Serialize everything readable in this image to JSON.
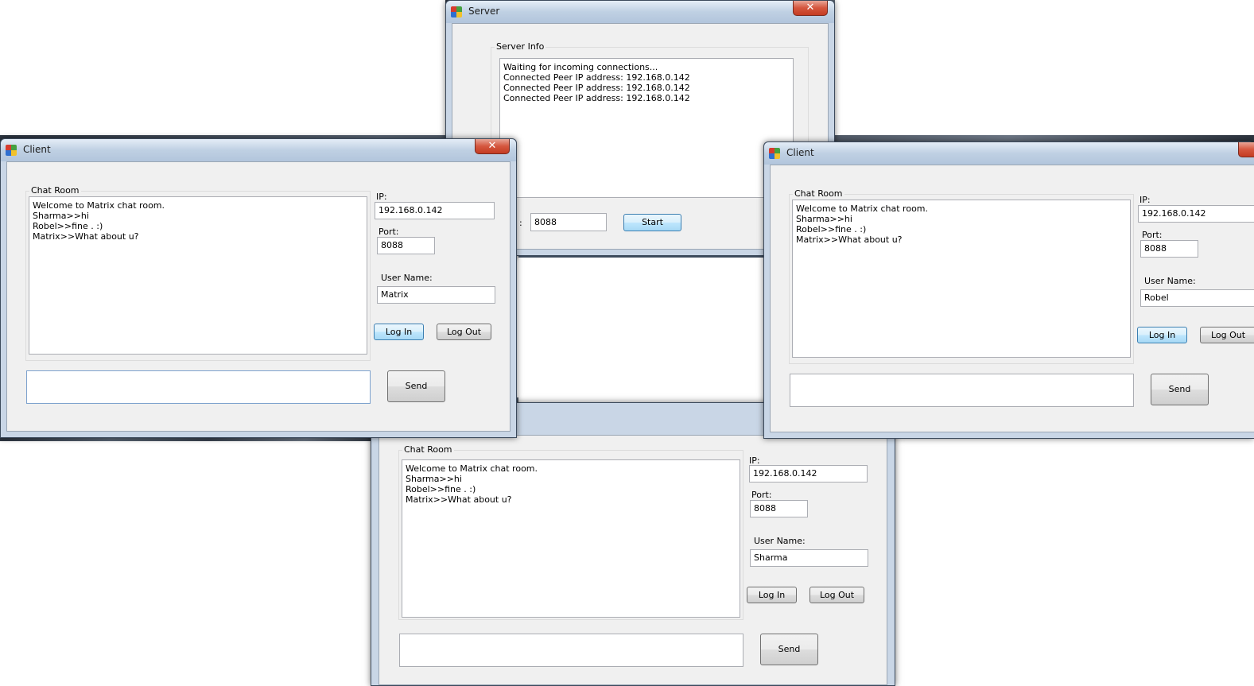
{
  "server": {
    "title": "Server",
    "close_glyph": "✕",
    "group_label": "Server Info",
    "log_lines": [
      "Waiting for incoming connections...",
      "Connected Peer IP address: 192.168.0.142",
      "Connected Peer IP address: 192.168.0.142",
      "Connected Peer IP address: 192.168.0.142"
    ],
    "port_label_fragment": ":",
    "port_value": "8088",
    "start_label": "Start"
  },
  "client_left": {
    "title": "Client",
    "close_glyph": "✕",
    "chat_group_label": "Chat Room",
    "chat_lines": [
      "Welcome to Matrix chat room.",
      "Sharma>>hi",
      "Robel>>fine . :)",
      "Matrix>>What about u?"
    ],
    "ip_label": "IP:",
    "ip_value": "192.168.0.142",
    "port_label": "Port:",
    "port_value": "8088",
    "username_label": "User Name:",
    "username_value": "Matrix",
    "login_label": "Log In",
    "logout_label": "Log Out",
    "message_value": "",
    "send_label": "Send"
  },
  "client_right": {
    "title": "Client",
    "chat_group_label": "Chat Room",
    "chat_lines": [
      "Welcome to Matrix chat room.",
      "Sharma>>hi",
      "Robel>>fine . :)",
      "Matrix>>What about u?"
    ],
    "ip_label": "IP:",
    "ip_value": "192.168.0.142",
    "port_label": "Port:",
    "port_value": "8088",
    "username_label": "User Name:",
    "username_value": "Robel",
    "login_label": "Log In",
    "logout_label": "Log Out",
    "message_value": "",
    "send_label": "Send"
  },
  "client_bottom": {
    "chat_group_label": "Chat Room",
    "chat_lines": [
      "Welcome to Matrix chat room.",
      "Sharma>>hi",
      "Robel>>fine . :)",
      "Matrix>>What about u?"
    ],
    "ip_label": "IP:",
    "ip_value": "192.168.0.142",
    "port_label": "Port:",
    "port_value": "8088",
    "username_label": "User Name:",
    "username_value": "Sharma",
    "login_label": "Log In",
    "logout_label": "Log Out",
    "message_value": "",
    "send_label": "Send"
  }
}
